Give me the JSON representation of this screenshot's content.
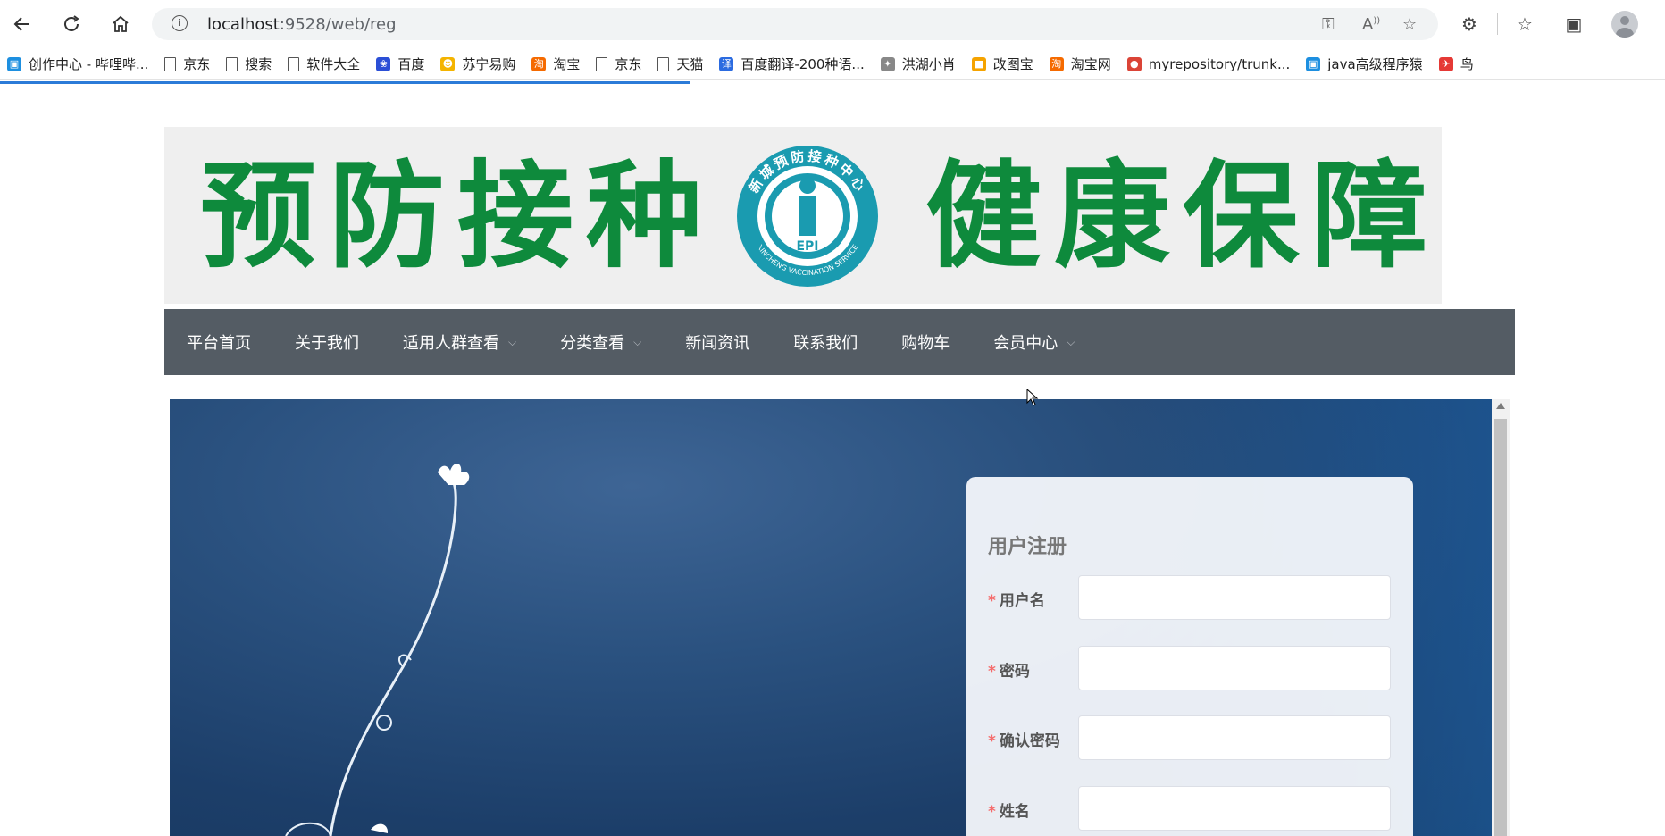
{
  "browser": {
    "url_host": "localhost",
    "url_path": ":9528/web/reg"
  },
  "bookmarks": [
    {
      "label": "创作中心 - 哔哩哔...",
      "icon": "bilibili-icon"
    },
    {
      "label": "京东",
      "icon": "page-icon"
    },
    {
      "label": "搜索",
      "icon": "page-icon"
    },
    {
      "label": "软件大全",
      "icon": "page-icon"
    },
    {
      "label": "百度",
      "icon": "baidu-icon"
    },
    {
      "label": "苏宁易购",
      "icon": "suning-icon"
    },
    {
      "label": "淘宝",
      "icon": "taobao-icon"
    },
    {
      "label": "京东",
      "icon": "page-icon"
    },
    {
      "label": "天猫",
      "icon": "page-icon"
    },
    {
      "label": "百度翻译-200种语...",
      "icon": "baidu-translate-icon"
    },
    {
      "label": "洪湖小肖",
      "icon": "bird-icon"
    },
    {
      "label": "改图宝",
      "icon": "gaitubao-icon"
    },
    {
      "label": "淘宝网",
      "icon": "taobao-icon"
    },
    {
      "label": "myrepository/trunk...",
      "icon": "chrome-icon"
    },
    {
      "label": "java高级程序猿",
      "icon": "bilibili-icon"
    },
    {
      "label": "鸟",
      "icon": "bird-red-icon"
    }
  ],
  "banner": {
    "left_text": "预防接种",
    "right_text": "健康保障",
    "logo_ring_text": "新城预防接种中心",
    "logo_bottom_text": "XINCHENG VACCINATION SERVICE",
    "logo_center_text": "EPI"
  },
  "nav": {
    "items": [
      {
        "label": "平台首页",
        "dropdown": false
      },
      {
        "label": "关于我们",
        "dropdown": false
      },
      {
        "label": "适用人群查看",
        "dropdown": true
      },
      {
        "label": "分类查看",
        "dropdown": true
      },
      {
        "label": "新闻资讯",
        "dropdown": false
      },
      {
        "label": "联系我们",
        "dropdown": false
      },
      {
        "label": "购物车",
        "dropdown": false
      },
      {
        "label": "会员中心",
        "dropdown": true
      }
    ]
  },
  "form": {
    "title": "用户注册",
    "required_mark": "*",
    "fields": [
      {
        "label": "用户名",
        "value": ""
      },
      {
        "label": "密码",
        "value": ""
      },
      {
        "label": "确认密码",
        "value": ""
      },
      {
        "label": "姓名",
        "value": ""
      }
    ]
  },
  "colors": {
    "banner_green": "#0e8a3c",
    "nav_bg": "#545c64",
    "required": "#f56c6c",
    "logo_teal": "#1a9bb0"
  }
}
